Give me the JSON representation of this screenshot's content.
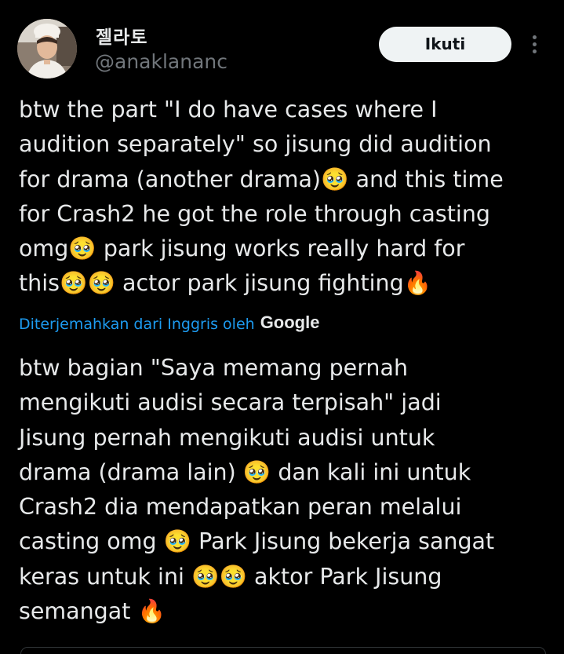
{
  "author": {
    "display_name": "젤라토",
    "handle": "@anaklananc"
  },
  "actions": {
    "follow_label": "Ikuti"
  },
  "tweet": {
    "original_text": "btw the part \"I do have cases where I\naudition separately\" so jisung did audition\nfor drama (another drama)🥹 and this time\nfor Crash2 he got the role through casting\nomg🥹 park jisung works really hard for\nthis🥹🥹 actor park jisung fighting🔥",
    "translated_by_label": "Diterjemahkan dari Inggris oleh",
    "translation_provider": "Google",
    "translated_text": "btw bagian \"Saya memang pernah\nmengikuti audisi secara terpisah\" jadi\nJisung pernah mengikuti audisi untuk\ndrama (drama lain) 🥹 dan kali ini untuk\nCrash2 dia mendapatkan peran melalui\ncasting omg 🥹 Park Jisung bekerja sangat\nkeras untuk ini 🥹🥹 aktor Park Jisung\nsemangat 🔥"
  },
  "colors": {
    "background": "#000000",
    "text_primary": "#e7e9ea",
    "text_secondary": "#71767b",
    "link": "#1d9bf0",
    "follow_button_bg": "#eff3f4"
  },
  "icons": {
    "more": "more-dots-vertical-icon",
    "avatar": "profile-photo"
  }
}
